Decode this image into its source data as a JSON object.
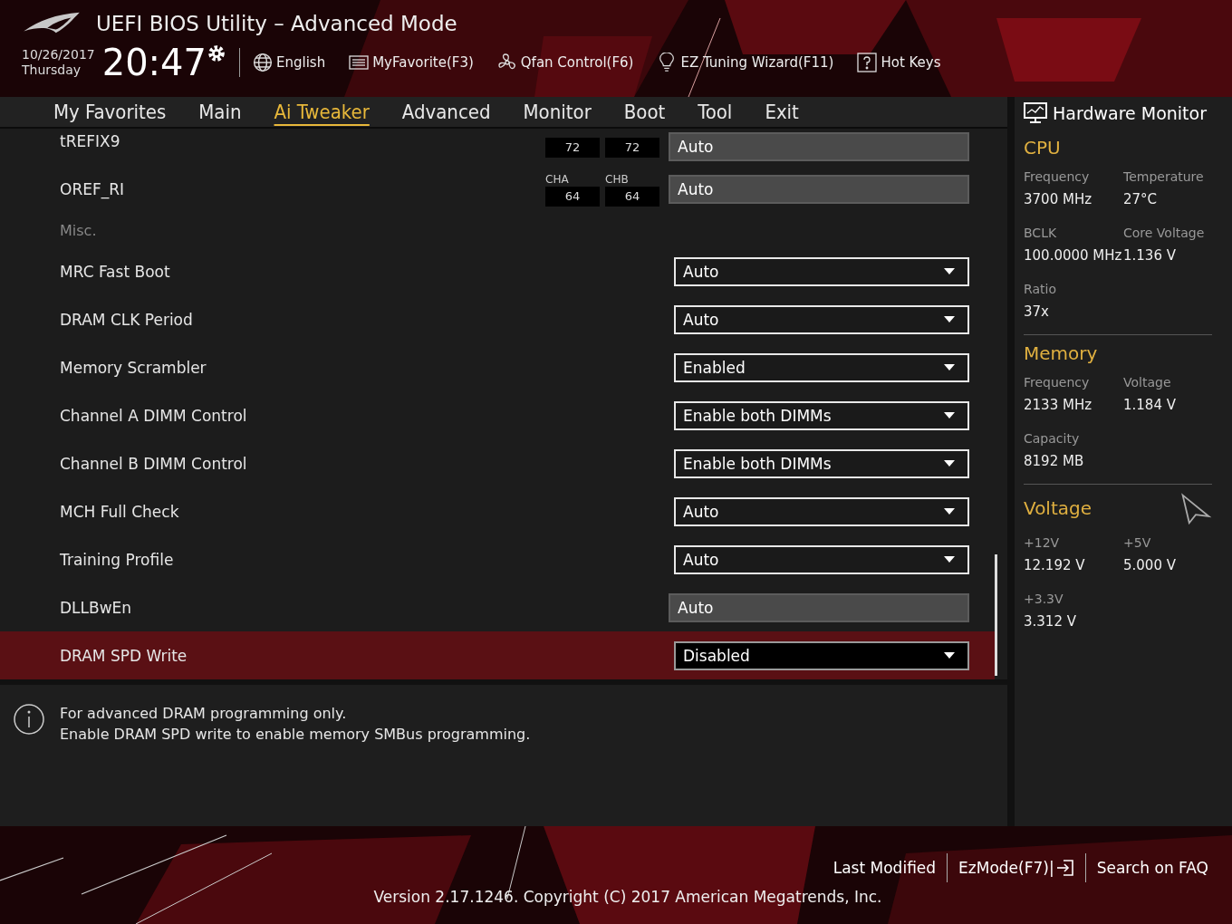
{
  "header": {
    "title": "UEFI BIOS Utility – Advanced Mode",
    "date": "10/26/2017",
    "day": "Thursday",
    "time": "20:47",
    "tools": [
      {
        "kind": "globe",
        "label": "English"
      },
      {
        "kind": "list",
        "label": "MyFavorite(F3)"
      },
      {
        "kind": "fan",
        "label": "Qfan Control(F6)"
      },
      {
        "kind": "bulb",
        "label": "EZ Tuning Wizard(F11)"
      },
      {
        "kind": "help",
        "label": "Hot Keys"
      }
    ]
  },
  "tabs": [
    {
      "label": "My Favorites",
      "selected": false
    },
    {
      "label": "Main",
      "selected": false
    },
    {
      "label": "Ai Tweaker",
      "selected": true
    },
    {
      "label": "Advanced",
      "selected": false
    },
    {
      "label": "Monitor",
      "selected": false
    },
    {
      "label": "Boot",
      "selected": false
    },
    {
      "label": "Tool",
      "selected": false
    },
    {
      "label": "Exit",
      "selected": false
    }
  ],
  "settings": [
    {
      "kind": "readonly",
      "label": "tREFIX9",
      "channels": [
        {
          "value": "72"
        },
        {
          "value": "72"
        }
      ],
      "value": "Auto",
      "selected": false
    },
    {
      "kind": "readonly",
      "label": "OREF_RI",
      "channels": [
        {
          "name": "CHA",
          "value": "64"
        },
        {
          "name": "CHB",
          "value": "64"
        }
      ],
      "value": "Auto",
      "selected": false
    },
    {
      "kind": "section",
      "label": "Misc."
    },
    {
      "kind": "dropdown",
      "label": "MRC Fast Boot",
      "value": "Auto",
      "selected": false
    },
    {
      "kind": "dropdown",
      "label": "DRAM CLK Period",
      "value": "Auto",
      "selected": false
    },
    {
      "kind": "dropdown",
      "label": "Memory Scrambler",
      "value": "Enabled",
      "selected": false
    },
    {
      "kind": "dropdown",
      "label": "Channel A DIMM Control",
      "value": "Enable both DIMMs",
      "selected": false
    },
    {
      "kind": "dropdown",
      "label": "Channel B DIMM Control",
      "value": "Enable both DIMMs",
      "selected": false
    },
    {
      "kind": "dropdown",
      "label": "MCH Full Check",
      "value": "Auto",
      "selected": false
    },
    {
      "kind": "dropdown",
      "label": "Training Profile",
      "value": "Auto",
      "selected": false
    },
    {
      "kind": "readonly",
      "label": "DLLBwEn",
      "value": "Auto",
      "selected": false
    },
    {
      "kind": "dropdown",
      "label": "DRAM SPD Write",
      "value": "Disabled",
      "selected": true
    }
  ],
  "help": [
    "For advanced DRAM programming only.",
    "Enable DRAM SPD write to enable memory SMBus programming."
  ],
  "hardware_monitor": {
    "title": "Hardware Monitor",
    "sections": [
      {
        "title": "CPU",
        "items": [
          {
            "label": "Frequency",
            "value": "3700 MHz"
          },
          {
            "label": "Temperature",
            "value": "27°C"
          },
          {
            "label": "BCLK",
            "value": "100.0000 MHz"
          },
          {
            "label": "Core Voltage",
            "value": "1.136 V"
          },
          {
            "label": "Ratio",
            "value": "37x"
          }
        ]
      },
      {
        "title": "Memory",
        "items": [
          {
            "label": "Frequency",
            "value": "2133 MHz"
          },
          {
            "label": "Voltage",
            "value": "1.184 V"
          },
          {
            "label": "Capacity",
            "value": "8192 MB"
          }
        ]
      },
      {
        "title": "Voltage",
        "items": [
          {
            "label": "+12V",
            "value": "12.192 V"
          },
          {
            "label": "+5V",
            "value": "5.000 V"
          },
          {
            "label": "+3.3V",
            "value": "3.312 V"
          }
        ]
      }
    ]
  },
  "footer": {
    "links": [
      "Last Modified",
      "EzMode(F7)|",
      "Search on FAQ"
    ],
    "version": "Version 2.17.1246. Copyright (C) 2017 American Megatrends, Inc."
  }
}
